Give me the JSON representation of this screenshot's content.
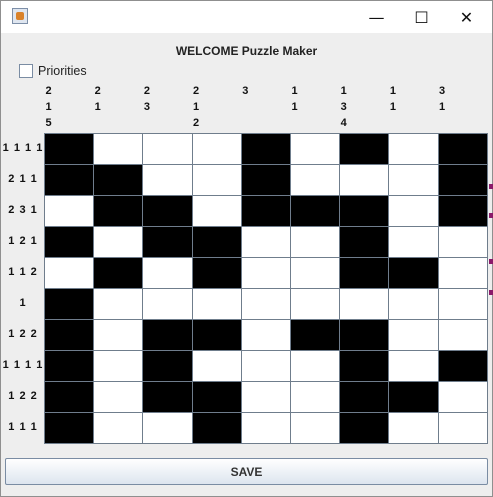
{
  "window": {
    "title": "",
    "minimize_glyph": "—",
    "maximize_glyph": "☐",
    "close_glyph": "✕",
    "icon": "java-cup-icon"
  },
  "heading": "WELCOME Puzzle Maker",
  "priorities": {
    "label": "Priorities",
    "checked": false
  },
  "column_clues": [
    "2\n1\n5",
    "2\n1",
    "2\n3",
    "2\n1\n2",
    "3",
    "1\n1",
    "1\n3\n4",
    "1\n1",
    "3\n1"
  ],
  "row_clues": [
    "1 1 1 1",
    "2 1 1",
    "2 3 1",
    "1 2 1",
    "1 1 2",
    "1",
    "1 2 2",
    "1 1 1 1",
    "1 2 2",
    "1 1 1"
  ],
  "grid": [
    [
      1,
      0,
      0,
      0,
      1,
      0,
      1,
      0,
      1
    ],
    [
      1,
      1,
      0,
      0,
      1,
      0,
      0,
      0,
      1
    ],
    [
      0,
      1,
      1,
      0,
      1,
      1,
      1,
      0,
      1
    ],
    [
      1,
      0,
      1,
      1,
      0,
      0,
      1,
      0,
      0
    ],
    [
      0,
      1,
      0,
      1,
      0,
      0,
      1,
      1,
      0
    ],
    [
      1,
      0,
      0,
      0,
      0,
      0,
      0,
      0,
      0
    ],
    [
      1,
      0,
      1,
      1,
      0,
      1,
      1,
      0,
      0
    ],
    [
      1,
      0,
      1,
      0,
      0,
      0,
      1,
      0,
      1
    ],
    [
      1,
      0,
      1,
      1,
      0,
      0,
      1,
      1,
      0
    ],
    [
      1,
      0,
      0,
      1,
      0,
      0,
      1,
      0,
      0
    ]
  ],
  "save_label": "SAVE",
  "colors": {
    "filled": "#000000",
    "empty": "#ffffff",
    "grid_line": "#6f7d8c"
  }
}
